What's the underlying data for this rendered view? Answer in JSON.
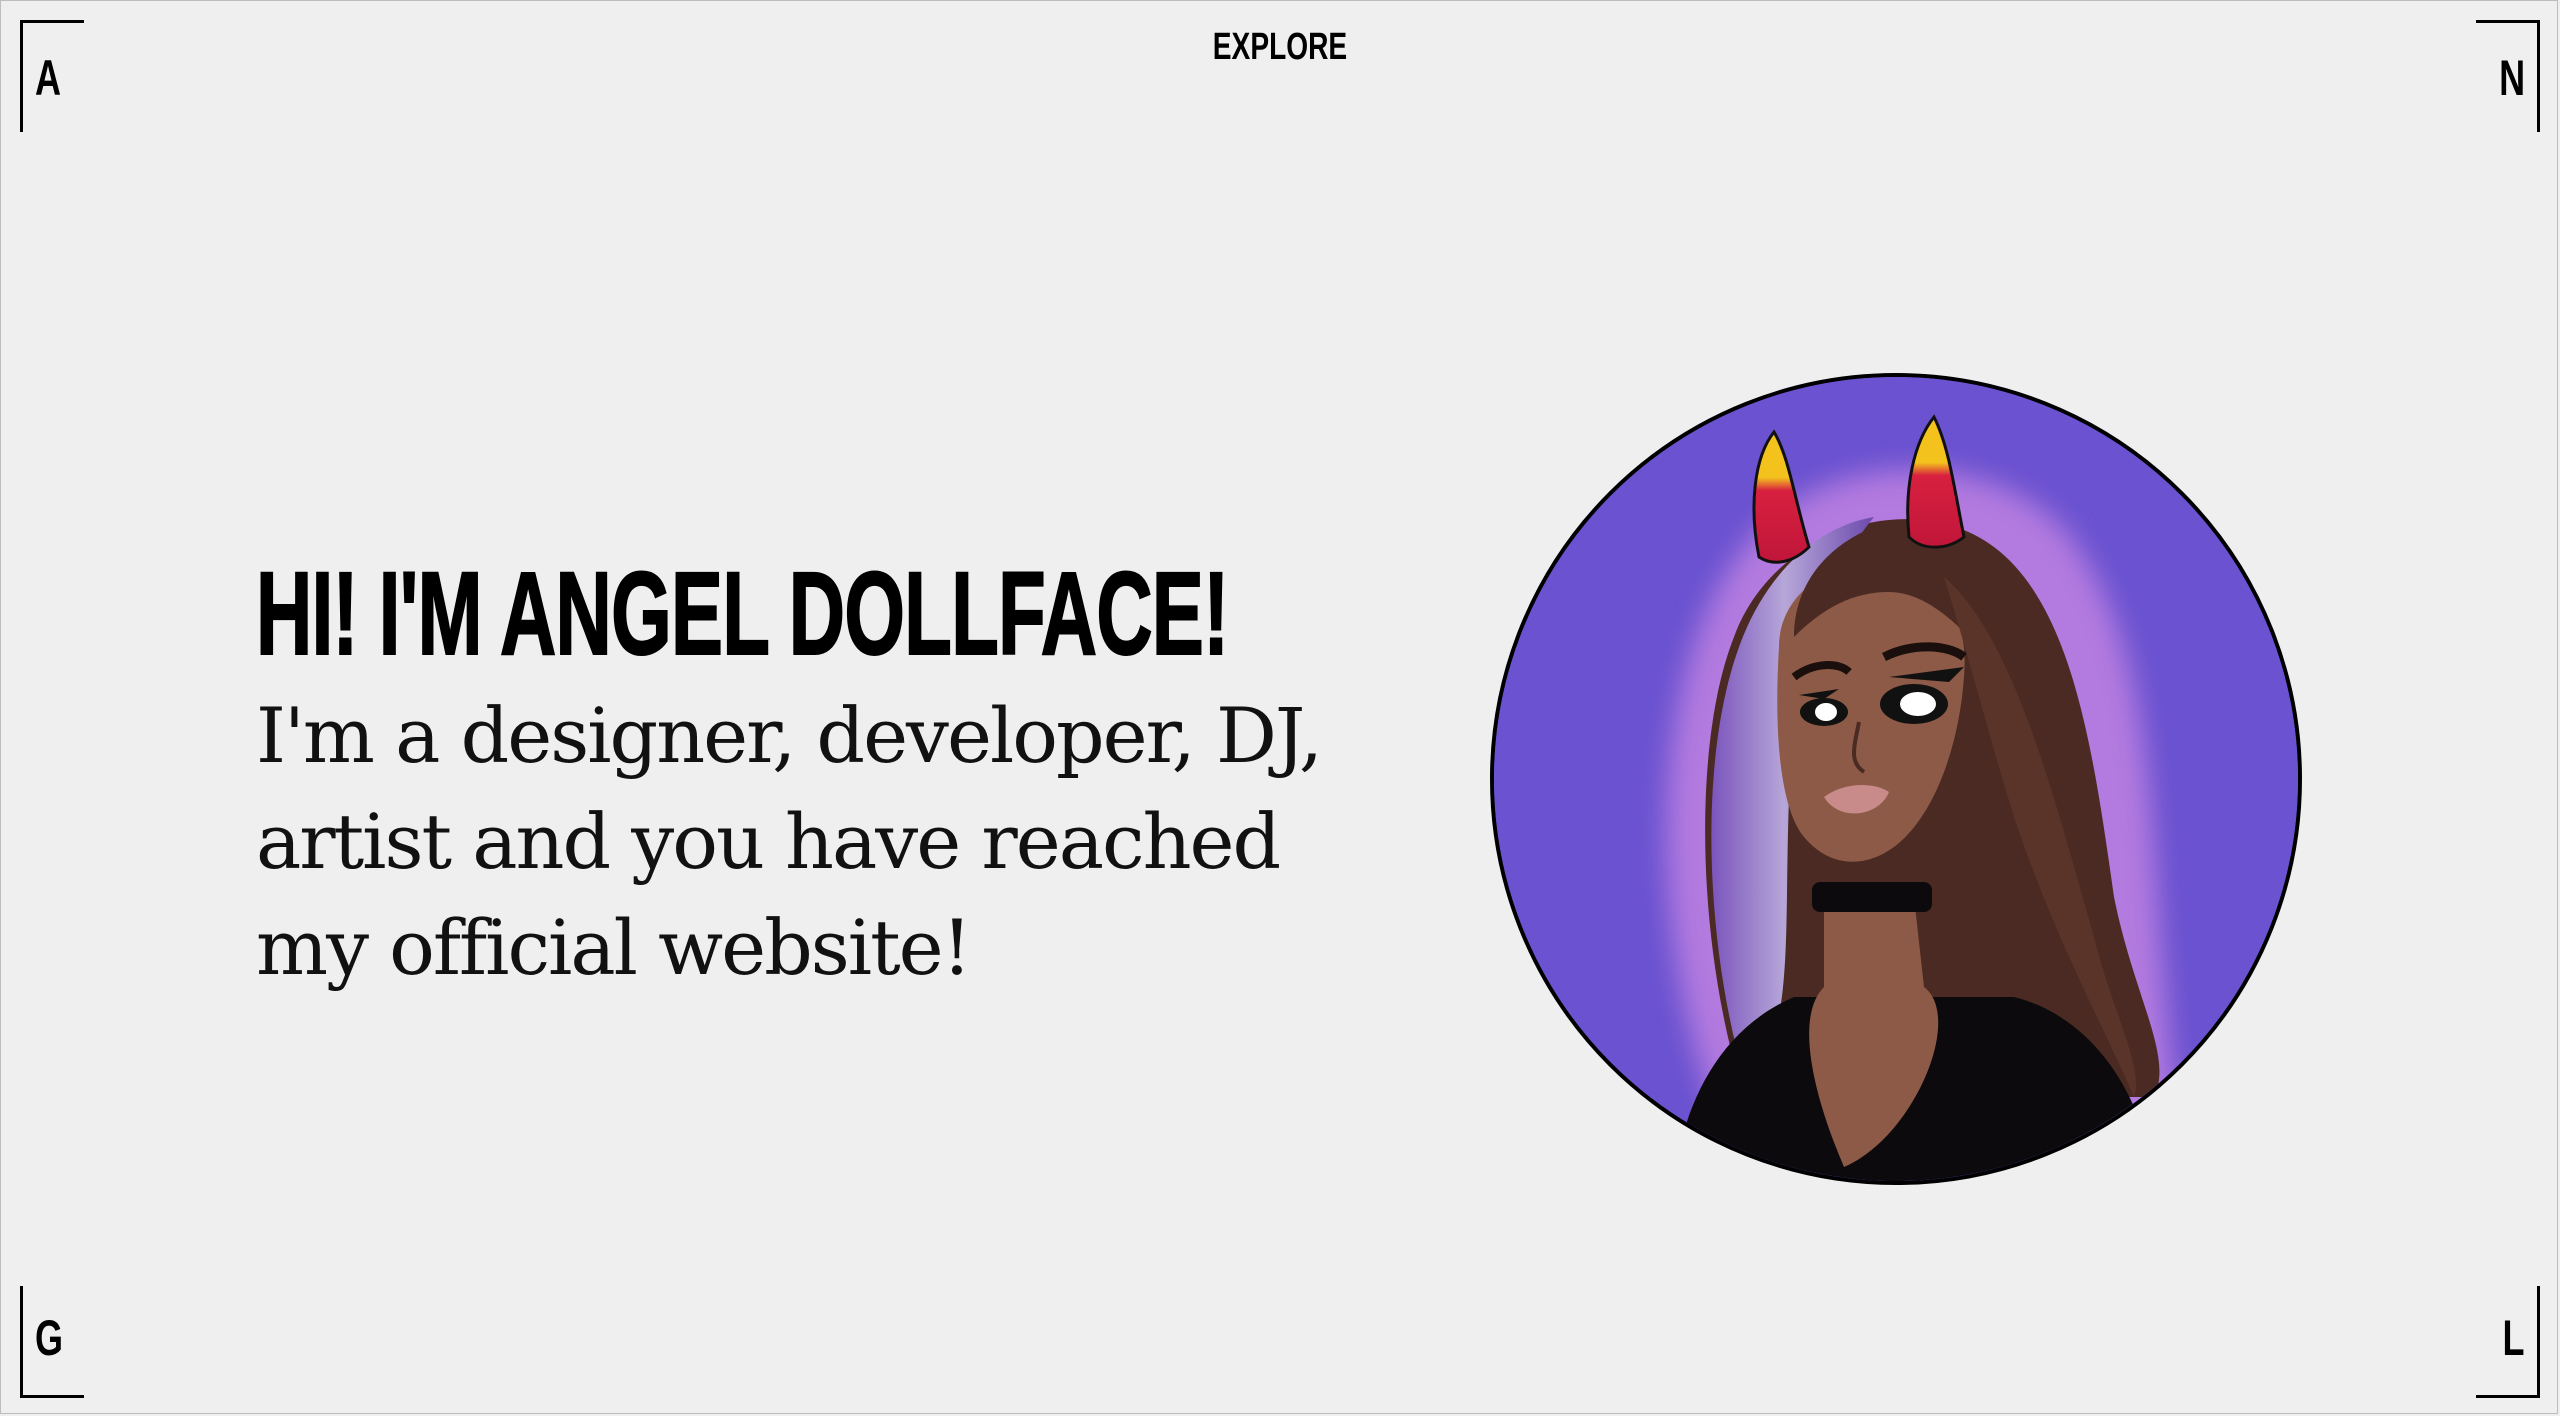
{
  "nav": {
    "explore_label": "EXPLORE"
  },
  "corners": {
    "top_left": "A",
    "top_right": "N",
    "bottom_left": "G",
    "bottom_right": "L"
  },
  "hero": {
    "title": "HI! I'M ANGEL DOLLFACE!",
    "subtitle": "I'm a designer, developer, DJ, artist and you have reached my official website!"
  },
  "colors": {
    "background": "#efefef",
    "avatar_bg": "#6a52d0",
    "avatar_glow": "#b77de0",
    "horn_red": "#d8203f",
    "horn_yellow": "#f3c21d",
    "hair_brown": "#4a2a22",
    "hair_purple": "#8a62c7",
    "skin": "#8c5a47"
  },
  "icons": {
    "avatar": "avatar-illustration"
  }
}
